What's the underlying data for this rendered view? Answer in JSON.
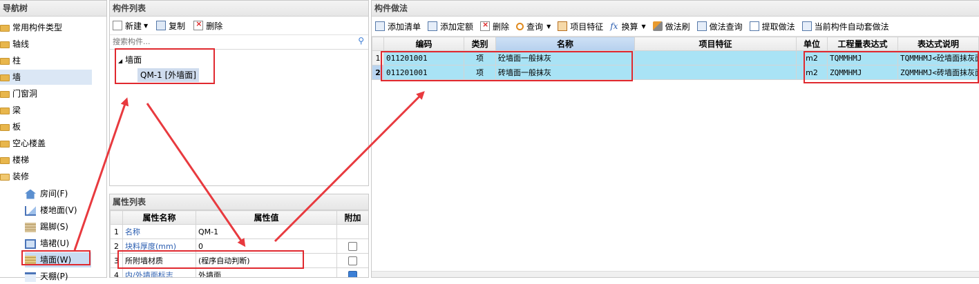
{
  "nav": {
    "title": "导航树",
    "items": [
      {
        "label": "常用构件类型"
      },
      {
        "label": "轴线"
      },
      {
        "label": "柱"
      },
      {
        "label": "墙"
      },
      {
        "label": "门窗洞"
      },
      {
        "label": "梁"
      },
      {
        "label": "板"
      },
      {
        "label": "空心楼盖"
      },
      {
        "label": "楼梯"
      },
      {
        "label": "装修"
      }
    ],
    "sub_items": [
      {
        "label": "房间(F)",
        "icon": "house-icon"
      },
      {
        "label": "楼地面(V)",
        "icon": "floor-icon"
      },
      {
        "label": "踢脚(S)",
        "icon": "skirting-icon"
      },
      {
        "label": "墙裙(U)",
        "icon": "wainscot-icon"
      },
      {
        "label": "墙面(W)",
        "icon": "wall-surface-icon"
      },
      {
        "label": "天棚(P)",
        "icon": "ceiling-icon"
      }
    ]
  },
  "component_list": {
    "title": "构件列表",
    "toolbar": {
      "new": "新建",
      "copy": "复制",
      "delete": "删除"
    },
    "search_placeholder": "搜索构件...",
    "tree_root": "墙面",
    "tree_child": "QM-1 [外墙面]"
  },
  "props": {
    "title": "属性列表",
    "headers": {
      "name": "属性名称",
      "value": "属性值",
      "extra": "附加"
    },
    "rows": [
      {
        "num": "1",
        "name": "名称",
        "value": "QM-1",
        "check": ""
      },
      {
        "num": "2",
        "name": "块料厚度(mm)",
        "value": "0",
        "check": "unchecked"
      },
      {
        "num": "3",
        "name": "所附墙材质",
        "value": "(程序自动判断)",
        "check": "unchecked"
      },
      {
        "num": "4",
        "name": "内/外墙面标志",
        "value": "外墙面",
        "check": "checked"
      }
    ]
  },
  "method": {
    "title": "构件做法",
    "toolbar": {
      "add_list": "添加清单",
      "add_quota": "添加定额",
      "delete": "删除",
      "query": "查询",
      "item_feature": "项目特征",
      "convert": "换算",
      "brush": "做法刷",
      "method_query": "做法查询",
      "extract": "提取做法",
      "auto_apply": "当前构件自动套做法"
    },
    "headers": {
      "code": "编码",
      "type": "类别",
      "name": "名称",
      "feature": "项目特征",
      "unit": "单位",
      "expr": "工程量表达式",
      "desc": "表达式说明"
    },
    "rows": [
      {
        "num": "1",
        "code": "011201001",
        "type": "项",
        "name": "砼墙面一般抹灰",
        "feature": "",
        "unit": "m2",
        "expr": "TQMMHMJ",
        "desc": "TQMMHMJ<砼墙面抹灰面积>"
      },
      {
        "num": "2",
        "code": "011201001",
        "type": "项",
        "name": "砖墙面一般抹灰",
        "feature": "",
        "unit": "m2",
        "expr": "ZQMMHMJ",
        "desc": "ZQMMHMJ<砖墙面抹灰面积>"
      }
    ]
  },
  "colors": {
    "highlight": "#e0282e",
    "row_bg": "#a9e3f5",
    "selected_nav": "#dbe7f5"
  }
}
